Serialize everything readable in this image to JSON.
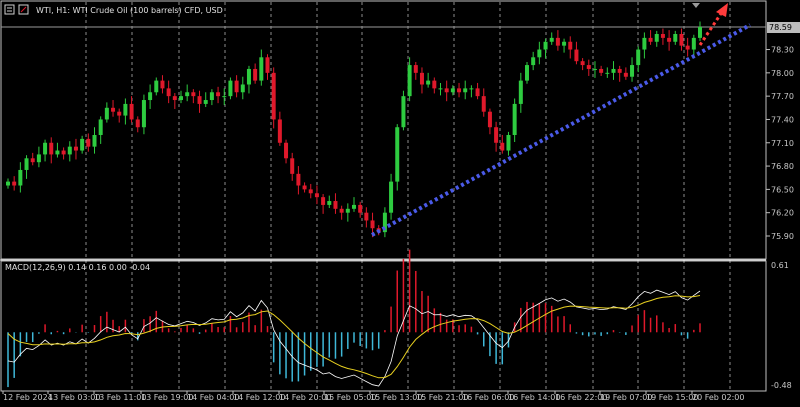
{
  "header": {
    "symbol_title": "WTI, H1:  WTI Crude Oil (100 barrels) CFD, USD"
  },
  "price_panel": {
    "current_price_tag": "78.59",
    "y_ticks": [
      "78.30",
      "78.00",
      "77.70",
      "77.40",
      "77.10",
      "76.80",
      "76.50",
      "76.20",
      "75.90"
    ]
  },
  "macd_panel": {
    "title": "MACD(12,26,9) 0.14 0.16 0.00 -0.04",
    "y_top_label": "0.61",
    "y_bottom_label": "-0.48"
  },
  "x_axis": {
    "labels": [
      "12 Feb 2024",
      "13 Feb 03:00",
      "13 Feb 11:00",
      "13 Feb 19:00",
      "14 Feb 04:00",
      "14 Feb 12:00",
      "14 Feb 20:00",
      "15 Feb 05:00",
      "15 Feb 13:00",
      "15 Feb 21:00",
      "16 Feb 06:00",
      "16 Feb 14:00",
      "16 Feb 22:00",
      "19 Feb 07:00",
      "19 Feb 15:00",
      "20 Feb 02:00"
    ]
  },
  "colors": {
    "background": "#000000",
    "bull_candle": "#2ecc40",
    "bear_candle": "#e0192b",
    "trendline": "#4a5ae8",
    "projection_arrow": "#ff3b3b",
    "macd_signal": "#e8d020",
    "macd_line": "#ffffff",
    "hist_positive": "#e0192b",
    "hist_negative": "#3fb8d8",
    "grid": "#ffffff"
  },
  "chart_data": {
    "type": "candlestick",
    "instrument": "WTI Crude Oil (100 barrels) CFD",
    "timeframe": "H1",
    "price_ylim": [
      75.8,
      78.7
    ],
    "price_ticks": [
      78.3,
      78.0,
      77.7,
      77.4,
      77.1,
      76.8,
      76.5,
      76.2,
      75.9
    ],
    "candles_close": [
      76.6,
      76.55,
      76.75,
      76.9,
      76.85,
      76.95,
      77.1,
      76.95,
      77.0,
      76.95,
      77.05,
      77.0,
      77.15,
      77.05,
      77.2,
      77.4,
      77.55,
      77.5,
      77.45,
      77.6,
      77.4,
      77.3,
      77.65,
      77.75,
      77.9,
      77.8,
      77.7,
      77.65,
      77.7,
      77.75,
      77.7,
      77.6,
      77.65,
      77.75,
      77.7,
      77.7,
      77.9,
      77.75,
      77.85,
      78.05,
      77.9,
      78.2,
      78.0,
      77.4,
      77.1,
      76.9,
      76.7,
      76.55,
      76.5,
      76.45,
      76.4,
      76.3,
      76.35,
      76.25,
      76.2,
      76.25,
      76.3,
      76.2,
      76.1,
      76.0,
      75.95,
      76.2,
      76.6,
      77.3,
      77.7,
      78.1,
      78.0,
      77.85,
      77.9,
      77.8,
      77.8,
      77.75,
      77.8,
      77.75,
      77.8,
      77.8,
      77.7,
      77.5,
      77.3,
      77.1,
      77.0,
      77.2,
      77.6,
      77.9,
      78.1,
      78.2,
      78.3,
      78.4,
      78.45,
      78.35,
      78.4,
      78.3,
      78.15,
      78.1,
      78.05,
      78.05,
      78.0,
      78.0,
      78.05,
      78.0,
      77.95,
      78.1,
      78.3,
      78.45,
      78.4,
      78.5,
      78.45,
      78.4,
      78.5,
      78.35,
      78.3,
      78.45,
      78.59
    ],
    "trendline": {
      "from": {
        "x_label": "15 Feb 05:00",
        "price": 75.92
      },
      "to": {
        "x_label": "20 Feb 02:00",
        "price": 78.58
      }
    },
    "macd": {
      "params": [
        12,
        26,
        9
      ],
      "values": [
        0.14,
        0.16,
        0.0,
        -0.04
      ],
      "ylim": [
        -0.48,
        0.61
      ]
    }
  }
}
